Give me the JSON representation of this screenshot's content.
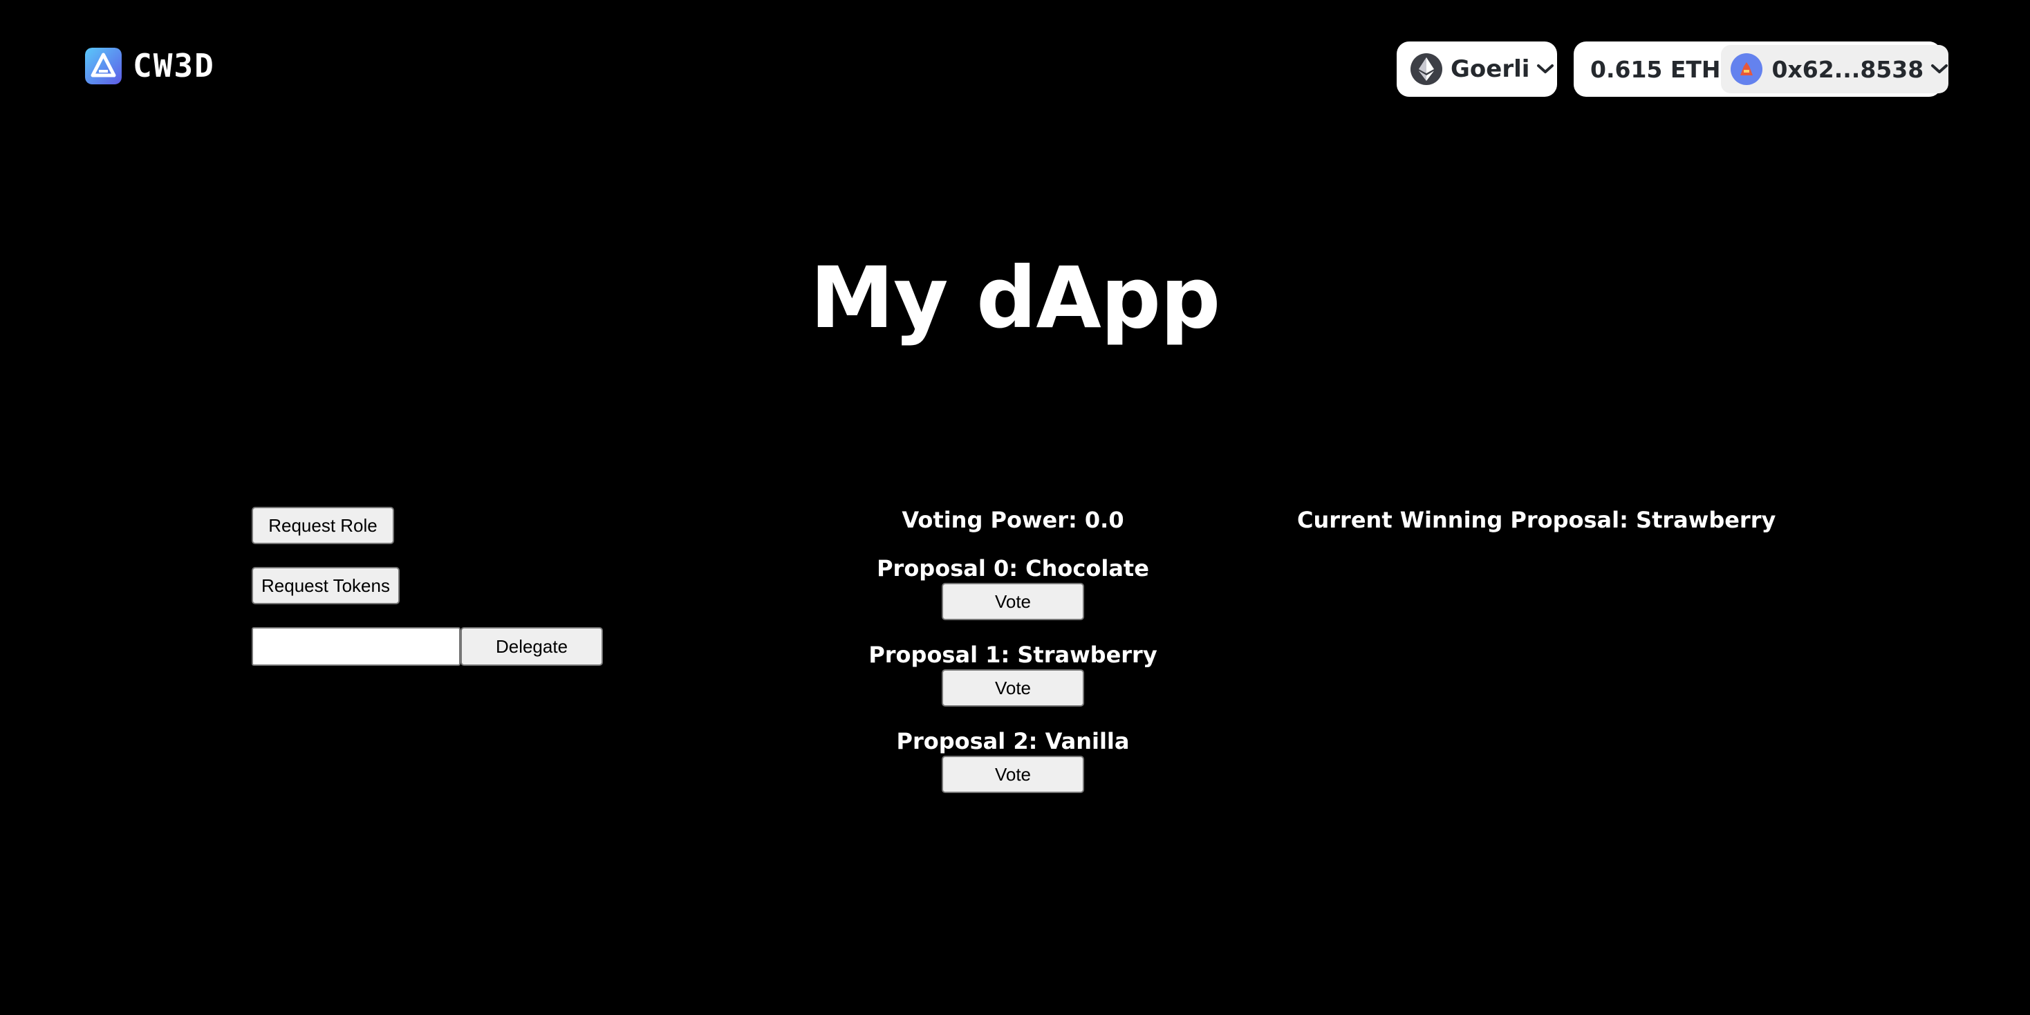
{
  "header": {
    "brand": "CW3D",
    "network": {
      "label": "Goerli",
      "icon": "ethereum-icon"
    },
    "wallet": {
      "balance": "0.615 ETH",
      "account": "0x62...8538"
    }
  },
  "main": {
    "title": "My dApp",
    "request_role_label": "Request Role",
    "request_tokens_label": "Request Tokens",
    "delegate": {
      "input_value": "",
      "input_placeholder": "",
      "button_label": "Delegate"
    },
    "voting_power": "Voting Power: 0.0",
    "winning_proposal": "Current Winning Proposal: Strawberry",
    "proposals": [
      {
        "label": "Proposal 0: Chocolate",
        "vote_label": "Vote"
      },
      {
        "label": "Proposal 1: Strawberry",
        "vote_label": "Vote"
      },
      {
        "label": "Proposal 2: Vanilla",
        "vote_label": "Vote"
      }
    ]
  },
  "colors": {
    "background": "#000000",
    "brand_gradient_start": "#5ac8fa",
    "brand_gradient_end": "#5e5ce6",
    "avatar_bg": "#6482ee"
  }
}
